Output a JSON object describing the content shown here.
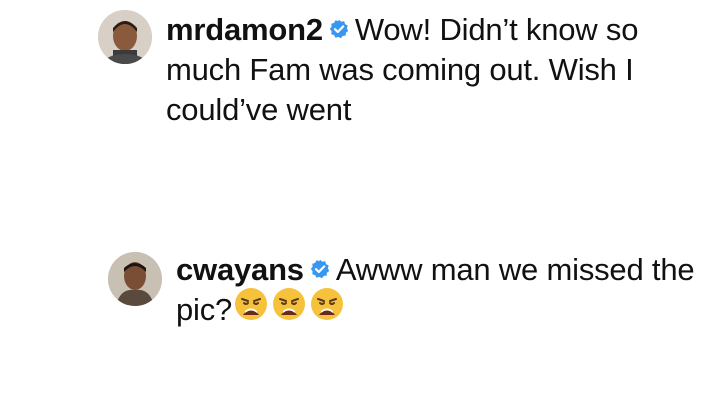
{
  "comments": [
    {
      "username": "mrdamon2",
      "verified": true,
      "text": "Wow! Didn’t know so much Fam was coming out. Wish I could’ve went",
      "avatar": "profile-photo"
    },
    {
      "username": "cwayans",
      "verified": true,
      "text": "Awww man we missed the pic?",
      "emojis": [
        "weary-face",
        "weary-face",
        "weary-face"
      ],
      "avatar": "profile-photo"
    }
  ],
  "colors": {
    "verified_badge": "#3897f0",
    "text": "#111111",
    "background": "#ffffff",
    "emoji_face": "#f7c23b"
  }
}
